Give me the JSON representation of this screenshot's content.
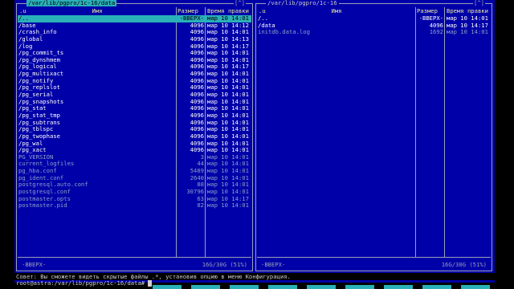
{
  "left_panel": {
    "path": " /var/lib/pgpro/1c-16/data ",
    "corner": "[^]",
    "headers": {
      "up": ".u",
      "name": "Имя",
      "size": "Размер",
      "time": "Время правки"
    },
    "rows": [
      {
        "name": "/..",
        "size": "-ВВЕРХ-",
        "time": "мар 10 14:01",
        "kind": "sel"
      },
      {
        "name": "/base",
        "size": "4096",
        "time": "мар 10 14:12",
        "kind": "dir"
      },
      {
        "name": "/crash_info",
        "size": "4096",
        "time": "мар 10 14:01",
        "kind": "dir"
      },
      {
        "name": "/global",
        "size": "4096",
        "time": "мар 10 14:13",
        "kind": "dir"
      },
      {
        "name": "/log",
        "size": "4096",
        "time": "мар 10 14:17",
        "kind": "dir"
      },
      {
        "name": "/pg_commit_ts",
        "size": "4096",
        "time": "мар 10 14:01",
        "kind": "dir"
      },
      {
        "name": "/pg_dynshmem",
        "size": "4096",
        "time": "мар 10 14:01",
        "kind": "dir"
      },
      {
        "name": "/pg_logical",
        "size": "4096",
        "time": "мар 10 14:17",
        "kind": "dir"
      },
      {
        "name": "/pg_multixact",
        "size": "4096",
        "time": "мар 10 14:01",
        "kind": "dir"
      },
      {
        "name": "/pg_notify",
        "size": "4096",
        "time": "мар 10 14:01",
        "kind": "dir"
      },
      {
        "name": "/pg_replslot",
        "size": "4096",
        "time": "мар 10 14:01",
        "kind": "dir"
      },
      {
        "name": "/pg_serial",
        "size": "4096",
        "time": "мар 10 14:01",
        "kind": "dir"
      },
      {
        "name": "/pg_snapshots",
        "size": "4096",
        "time": "мар 10 14:01",
        "kind": "dir"
      },
      {
        "name": "/pg_stat",
        "size": "4096",
        "time": "мар 10 14:01",
        "kind": "dir"
      },
      {
        "name": "/pg_stat_tmp",
        "size": "4096",
        "time": "мар 10 14:01",
        "kind": "dir"
      },
      {
        "name": "/pg_subtrans",
        "size": "4096",
        "time": "мар 10 14:01",
        "kind": "dir"
      },
      {
        "name": "/pg_tblspc",
        "size": "4096",
        "time": "мар 10 14:01",
        "kind": "dir"
      },
      {
        "name": "/pg_twophase",
        "size": "4096",
        "time": "мар 10 14:01",
        "kind": "dir"
      },
      {
        "name": "/pg_wal",
        "size": "4096",
        "time": "мар 10 14:01",
        "kind": "dir"
      },
      {
        "name": "/pg_xact",
        "size": "4096",
        "time": "мар 10 14:01",
        "kind": "dir"
      },
      {
        "name": " PG_VERSION",
        "size": "3",
        "time": "мар 10 14:01",
        "kind": "file"
      },
      {
        "name": " current_logfiles",
        "size": "44",
        "time": "мар 10 14:01",
        "kind": "file"
      },
      {
        "name": " pg_hba.conf",
        "size": "5489",
        "time": "мар 10 14:01",
        "kind": "file"
      },
      {
        "name": " pg_ident.conf",
        "size": "2640",
        "time": "мар 10 14:01",
        "kind": "file"
      },
      {
        "name": " postgresql.auto.conf",
        "size": "88",
        "time": "мар 10 14:01",
        "kind": "file"
      },
      {
        "name": " postgresql.conf",
        "size": "30796",
        "time": "мар 10 14:01",
        "kind": "file"
      },
      {
        "name": " postmaster.opts",
        "size": "63",
        "time": "мар 10 14:17",
        "kind": "file"
      },
      {
        "name": " postmaster.pid",
        "size": "82",
        "time": "мар 10 14:01",
        "kind": "file"
      }
    ],
    "status_left": "-ВВЕРХ-",
    "status_right": "16G/30G (51%)"
  },
  "right_panel": {
    "path": " /var/lib/pgpro/1c-16 ",
    "corner": "[^]",
    "headers": {
      "up": ".u",
      "name": "Имя",
      "size": "Размер",
      "time": "Время правки"
    },
    "rows": [
      {
        "name": "/..",
        "size": "-ВВЕРХ-",
        "time": "мар 10 14:01",
        "kind": "dir"
      },
      {
        "name": "/data",
        "size": "4096",
        "time": "мар 10 14:17",
        "kind": "dir"
      },
      {
        "name": " initdb.data.log",
        "size": "1692",
        "time": "мар 10 14:01",
        "kind": "file"
      }
    ],
    "status_left": "-ВВЕРХ-",
    "status_right": "16G/30G (51%)"
  },
  "hint": "Совет: Вы сможете видеть скрытые файлы .*, установив опцию в меню Конфигурация.",
  "command_line": "root@astra:/var/lib/pgpro/1c-16/data# ",
  "colors": {
    "panel_bg": "#0000a8",
    "selection": "#2ab0b8",
    "directory": "#ffffff",
    "file": "#8aa0c8",
    "header": "#e8e8a0"
  }
}
